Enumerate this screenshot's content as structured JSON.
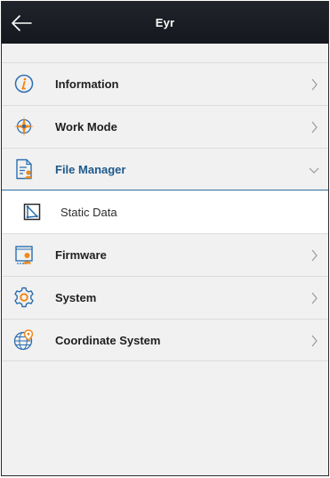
{
  "header": {
    "title": "Eyr",
    "back_icon": "arrow-left-icon"
  },
  "menu": {
    "information": {
      "label": "Information",
      "icon": "info-icon"
    },
    "work_mode": {
      "label": "Work Mode",
      "icon": "compass-icon"
    },
    "file_manager": {
      "label": "File Manager",
      "icon": "file-manager-icon",
      "expanded": true
    },
    "static_data": {
      "label": "Static Data",
      "icon": "static-data-icon"
    },
    "firmware": {
      "label": "Firmware",
      "icon": "firmware-icon"
    },
    "system": {
      "label": "System",
      "icon": "gear-icon"
    },
    "coordinate_system": {
      "label": "Coordinate System",
      "icon": "globe-pin-icon"
    }
  },
  "colors": {
    "header_bg": "#1a1d24",
    "accent": "#1d5a8c",
    "icon_orange": "#f08a1c",
    "icon_blue": "#2c6fb0"
  }
}
